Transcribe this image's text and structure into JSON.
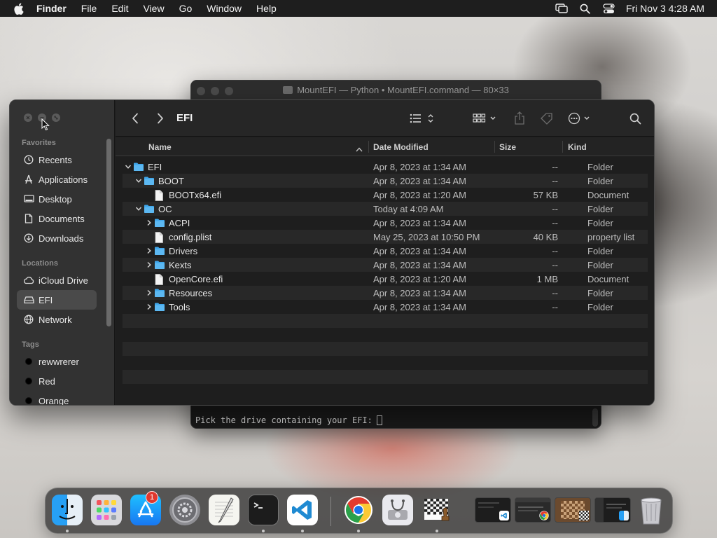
{
  "menubar": {
    "app_name": "Finder",
    "menus": [
      "File",
      "Edit",
      "View",
      "Go",
      "Window",
      "Help"
    ],
    "clock": "Fri Nov 3  4:28 AM"
  },
  "terminal": {
    "title": "MountEFI — Python • MountEFI.command — 80×33",
    "prompt": "Pick the drive containing your EFI:"
  },
  "finder": {
    "path_title": "EFI",
    "sidebar": {
      "favorites_title": "Favorites",
      "favorites": [
        "Recents",
        "Applications",
        "Desktop",
        "Documents",
        "Downloads"
      ],
      "locations_title": "Locations",
      "locations": [
        "iCloud Drive",
        "EFI",
        "Network"
      ],
      "selected_location": "EFI",
      "tags_title": "Tags",
      "tags": [
        {
          "name": "rewwrerer",
          "color": "#000000"
        },
        {
          "name": "Red",
          "color": "#000000"
        },
        {
          "name": "Orange",
          "color": "#000000"
        }
      ]
    },
    "columns": {
      "name": "Name",
      "date": "Date Modified",
      "size": "Size",
      "kind": "Kind"
    },
    "rows": [
      {
        "name": "EFI",
        "date": "Apr 8, 2023 at 1:34 AM",
        "size": "--",
        "kind": "Folder",
        "type": "folder",
        "depth": 0,
        "disclosure": "open"
      },
      {
        "name": "BOOT",
        "date": "Apr 8, 2023 at 1:34 AM",
        "size": "--",
        "kind": "Folder",
        "type": "folder",
        "depth": 1,
        "disclosure": "open"
      },
      {
        "name": "BOOTx64.efi",
        "date": "Apr 8, 2023 at 1:20 AM",
        "size": "57 KB",
        "kind": "Document",
        "type": "file",
        "depth": 2,
        "disclosure": "none"
      },
      {
        "name": "OC",
        "date": "Today at 4:09 AM",
        "size": "--",
        "kind": "Folder",
        "type": "folder",
        "depth": 1,
        "disclosure": "open"
      },
      {
        "name": "ACPI",
        "date": "Apr 8, 2023 at 1:34 AM",
        "size": "--",
        "kind": "Folder",
        "type": "folder",
        "depth": 2,
        "disclosure": "closed"
      },
      {
        "name": "config.plist",
        "date": "May 25, 2023 at 10:50 PM",
        "size": "40 KB",
        "kind": "property list",
        "type": "file",
        "depth": 2,
        "disclosure": "none"
      },
      {
        "name": "Drivers",
        "date": "Apr 8, 2023 at 1:34 AM",
        "size": "--",
        "kind": "Folder",
        "type": "folder",
        "depth": 2,
        "disclosure": "closed"
      },
      {
        "name": "Kexts",
        "date": "Apr 8, 2023 at 1:34 AM",
        "size": "--",
        "kind": "Folder",
        "type": "folder",
        "depth": 2,
        "disclosure": "closed"
      },
      {
        "name": "OpenCore.efi",
        "date": "Apr 8, 2023 at 1:20 AM",
        "size": "1 MB",
        "kind": "Document",
        "type": "file",
        "depth": 2,
        "disclosure": "none"
      },
      {
        "name": "Resources",
        "date": "Apr 8, 2023 at 1:34 AM",
        "size": "--",
        "kind": "Folder",
        "type": "folder",
        "depth": 2,
        "disclosure": "closed"
      },
      {
        "name": "Tools",
        "date": "Apr 8, 2023 at 1:34 AM",
        "size": "--",
        "kind": "Folder",
        "type": "folder",
        "depth": 2,
        "disclosure": "closed"
      }
    ]
  },
  "dock": {
    "apps": [
      "finder-icon",
      "launchpad-icon",
      "app-store-icon",
      "system-settings-icon",
      "textedit-icon",
      "terminal-icon",
      "vscode-icon",
      "chrome-icon",
      "disk-utility-icon",
      "chess-icon"
    ],
    "settings_badge": "1"
  },
  "colors": {
    "folder_blue": "#3fa6ea",
    "menubar_bg": "#1e1e1e",
    "finder_bg": "#1e1e1e",
    "badge_red": "#e0382e"
  }
}
